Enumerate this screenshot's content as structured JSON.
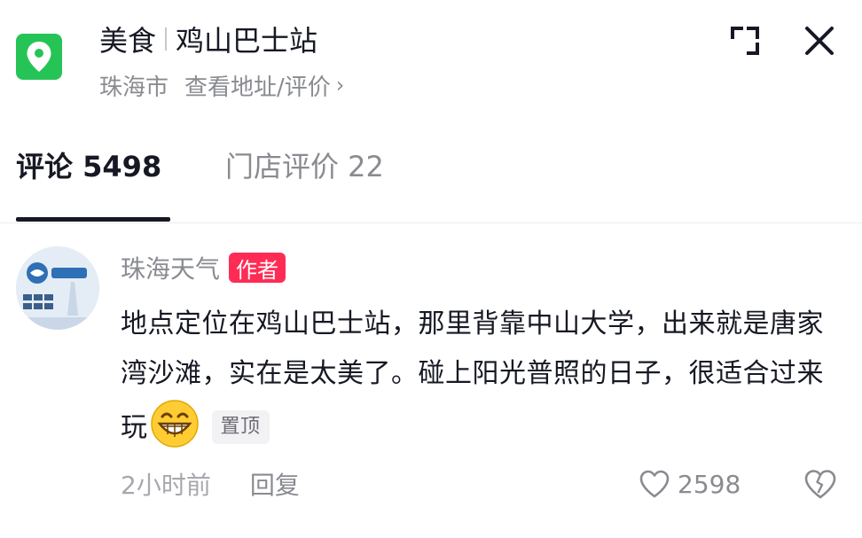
{
  "header": {
    "category": "美食",
    "place_name": "鸡山巴士站",
    "city": "珠海市",
    "view_address_link": "查看地址/评价",
    "chevron": "›"
  },
  "tabs": [
    {
      "label": "评论 5498",
      "active": true
    },
    {
      "label": "门店评价 22",
      "active": false
    }
  ],
  "comment": {
    "author": "珠海天气",
    "author_badge": "作者",
    "text": "地点定位在鸡山巴士站，那里背靠中山大学，出来就是唐家湾沙滩，实在是太美了。碰上阳光普照的日子，很适合过来玩",
    "emoji": "grinning-face-emoji",
    "pin_label": "置顶",
    "time": "2小时前",
    "reply_label": "回复",
    "like_count": "2598"
  },
  "colors": {
    "location_green": "#26c456",
    "author_badge_red": "#fe2c55",
    "secondary_text": "#8a8b91"
  },
  "icons": {
    "location": "location-pin-icon",
    "expand": "expand-icon",
    "close": "close-icon",
    "like": "heart-icon",
    "dislike": "broken-heart-icon"
  }
}
